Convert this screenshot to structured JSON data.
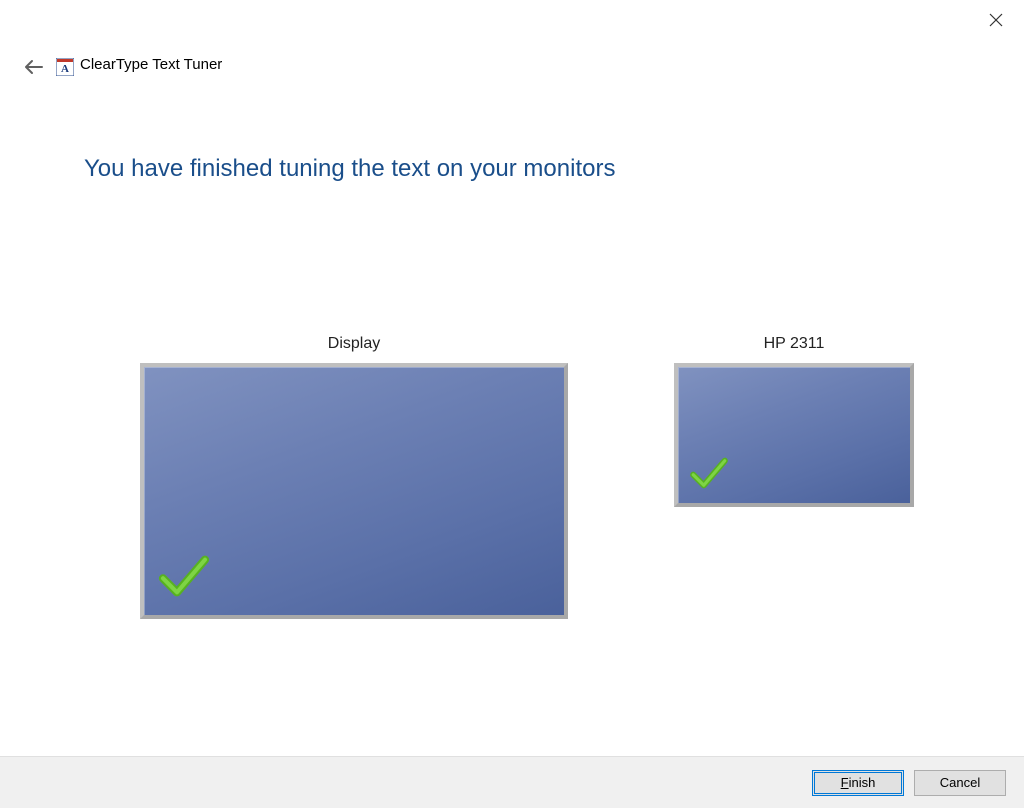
{
  "window": {
    "app_title": "ClearType Text Tuner"
  },
  "main": {
    "heading": "You have finished tuning the text on your monitors"
  },
  "monitors": [
    {
      "label": "Display",
      "primary": true,
      "tuned": true
    },
    {
      "label": "HP 2311",
      "primary": false,
      "tuned": true
    }
  ],
  "footer": {
    "primary_button": "Finish",
    "secondary_button": "Cancel"
  },
  "colors": {
    "heading": "#1a4e8a",
    "monitor_fill_top": "#8092c0",
    "monitor_fill_bottom": "#4a619b",
    "check": "#57b220",
    "footer_bg": "#f0f0f0",
    "button_bg": "#e1e1e1",
    "accent": "#0078d7"
  }
}
